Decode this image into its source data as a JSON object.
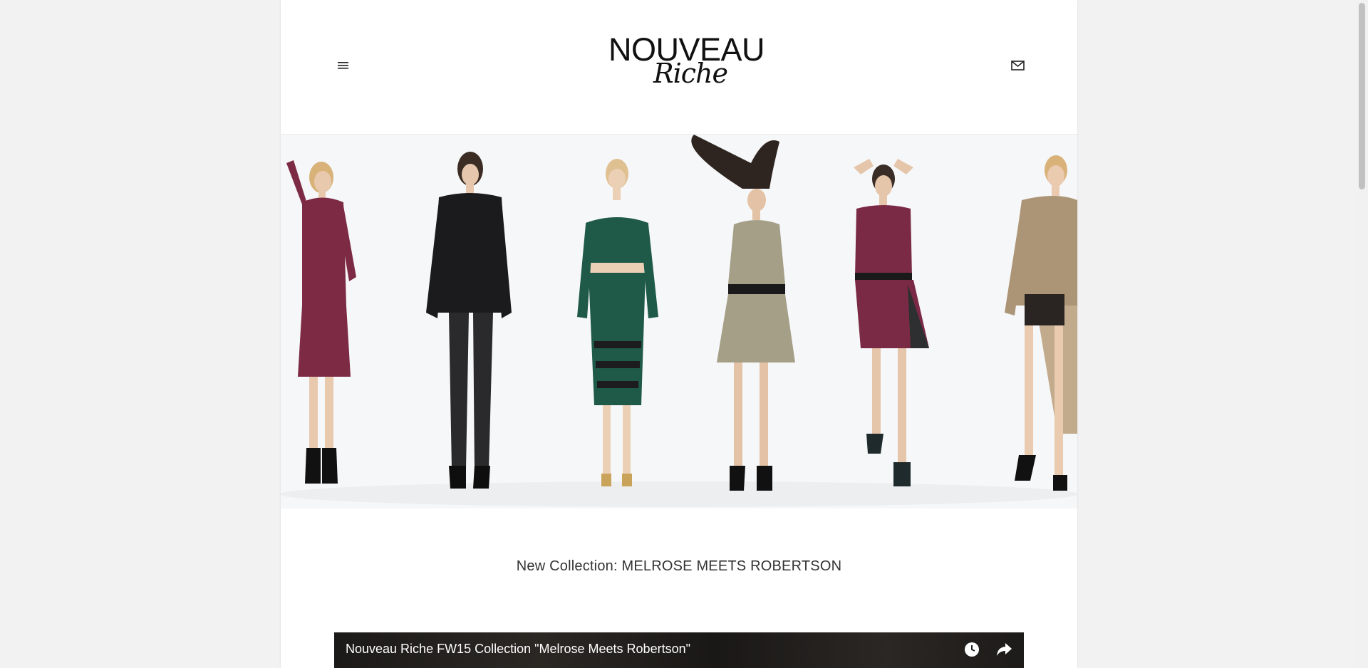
{
  "header": {
    "menu_icon": "hamburger-menu-icon",
    "contact_icon": "envelope-icon",
    "logo": {
      "line1": "NOUVEAU",
      "line2": "Riche"
    }
  },
  "hero": {
    "image_subject": "six models wearing the collection",
    "outfit_colors": [
      "#7d2a45",
      "#1b1b1d",
      "#1f5a49",
      "#a59f88",
      "#7a2a44",
      "#ac9577"
    ],
    "background": "#f6f7f8"
  },
  "main": {
    "collection_title": "New Collection: MELROSE MEETS ROBERTSON"
  },
  "video": {
    "title": "Nouveau Riche FW15 Collection \"Melrose Meets Robertson\"",
    "watch_later_icon": "clock-icon",
    "share_icon": "share-arrow-icon"
  }
}
